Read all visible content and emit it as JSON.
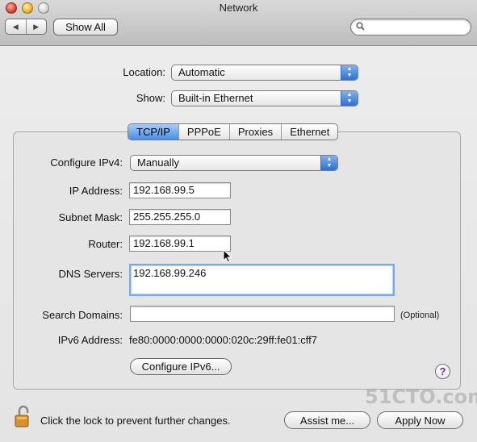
{
  "window": {
    "title": "Network"
  },
  "toolbar": {
    "back_icon": "left-arrow-icon",
    "forward_icon": "right-arrow-icon",
    "show_all_label": "Show All",
    "search_placeholder": ""
  },
  "location": {
    "label": "Location:",
    "value": "Automatic"
  },
  "show": {
    "label": "Show:",
    "value": "Built-in Ethernet"
  },
  "tabs": [
    {
      "label": "TCP/IP",
      "active": true
    },
    {
      "label": "PPPoE",
      "active": false
    },
    {
      "label": "Proxies",
      "active": false
    },
    {
      "label": "Ethernet",
      "active": false
    }
  ],
  "tcpip": {
    "configure_ipv4": {
      "label": "Configure IPv4:",
      "value": "Manually"
    },
    "ip_address": {
      "label": "IP Address:",
      "value": "192.168.99.5"
    },
    "subnet_mask": {
      "label": "Subnet Mask:",
      "value": "255.255.255.0"
    },
    "router": {
      "label": "Router:",
      "value": "192.168.99.1"
    },
    "dns_servers": {
      "label": "DNS Servers:",
      "value": "192.168.99.246"
    },
    "search_domains": {
      "label": "Search Domains:",
      "value": "",
      "hint": "(Optional)"
    },
    "ipv6_address": {
      "label": "IPv6 Address:",
      "value": "fe80:0000:0000:0000:020c:29ff:fe01:cff7"
    },
    "configure_ipv6_label": "Configure IPv6..."
  },
  "footer": {
    "lock_text": "Click the lock to prevent further changes.",
    "assist_label": "Assist me...",
    "apply_label": "Apply Now"
  },
  "watermark": "51CTO.com"
}
